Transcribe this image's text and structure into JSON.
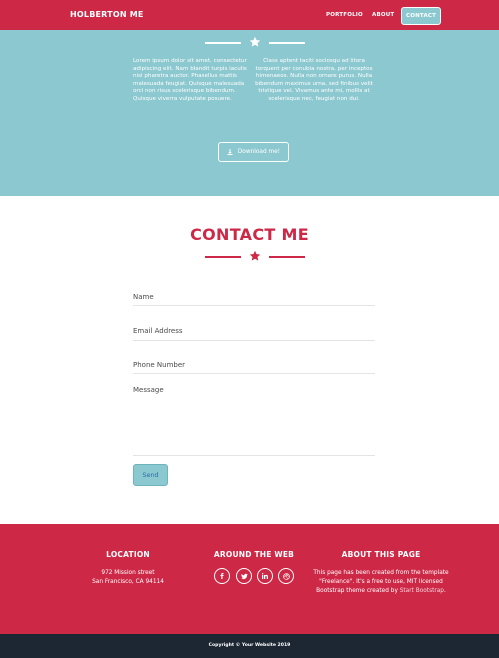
{
  "nav": {
    "brand": "HOLBERTON ME",
    "links": [
      "PORTFOLIO",
      "ABOUT",
      "CONTACT"
    ]
  },
  "about": {
    "left_text": "Lorem ipsum dolor sit amet, consectetur adipiscing elit. Nam blandit turpis iaculis nisl pharetra auctor. Phasellus mattis malesuada feugiat. Quisque malesuada orci non risus scelerisque bibendum. Quisque viverra vulputate posuere.",
    "right_text": "Class aptent taciti sociosqu ad litora torquent per conubia nostra, per inceptos himenaeos. Nulla non ornare purus. Nulla bibendum maximus urna, sed finibus velit tristique vel. Vivamus ante mi, mollis at scelerisque nec, feugiat non dui.",
    "download_label": "Download me!"
  },
  "contact": {
    "title": "CONTACT ME",
    "fields": {
      "name": "Name",
      "email": "Email Address",
      "phone": "Phone Number",
      "message": "Message"
    },
    "send_label": "Send"
  },
  "footer": {
    "location_title": "LOCATION",
    "location_line1": "972 Mission street",
    "location_line2": "San Francisco, CA 94114",
    "around_title": "AROUND THE WEB",
    "about_title": "ABOUT THIS PAGE",
    "about_text_1": "This page has been created from the template \"Freelance\". It's a free to use, MIT licensed Bootstrap theme created by ",
    "about_link": "Start Bootstrap",
    "about_text_2": "."
  },
  "copyright": "Copyright © Your Website 2019",
  "colors": {
    "primary": "#cd2947",
    "teal": "#8cc8cf",
    "dark": "#1d2733"
  },
  "icons": {
    "social": [
      "facebook-icon",
      "twitter-icon",
      "linkedin-icon",
      "dribbble-icon"
    ]
  }
}
